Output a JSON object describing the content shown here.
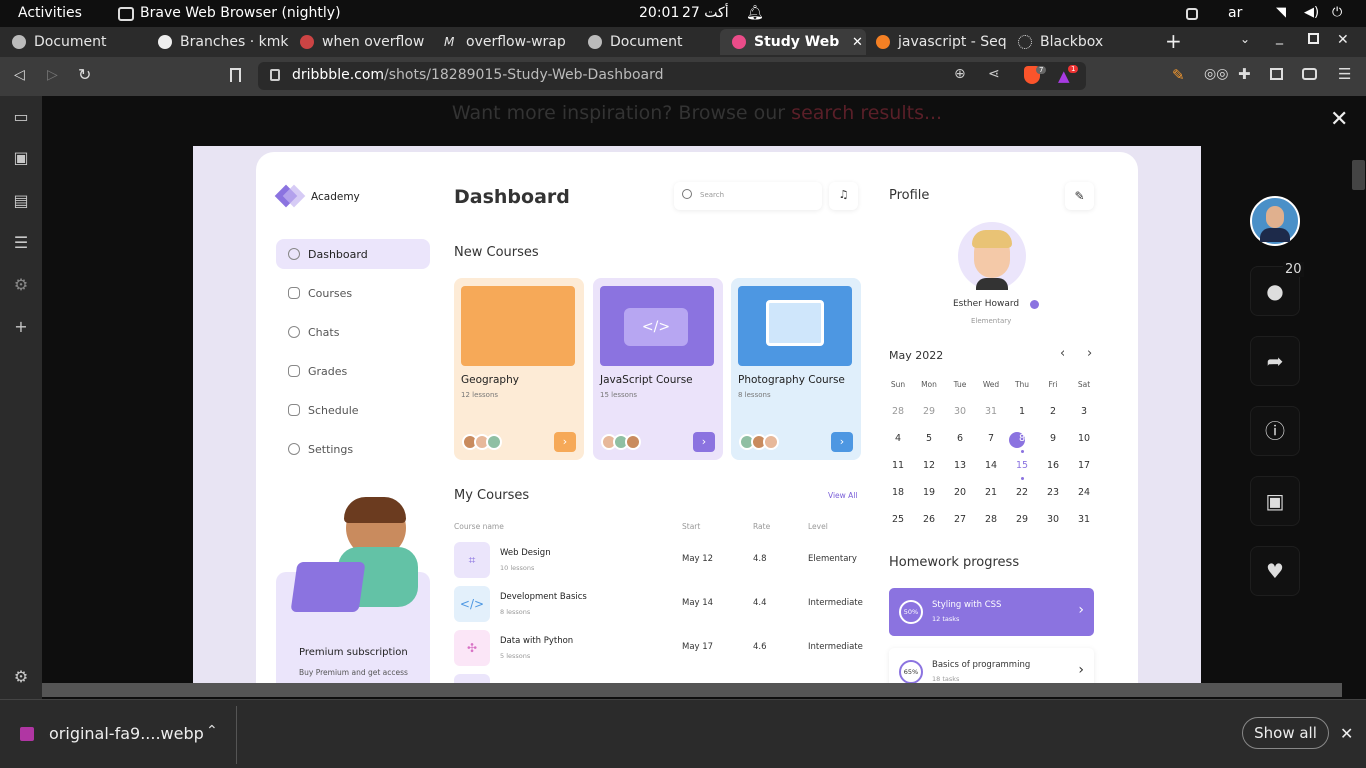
{
  "system": {
    "activities": "Activities",
    "app_name": "Brave Web Browser (nightly)",
    "clock": "20:01",
    "date": "أكت 27",
    "lang": "ar"
  },
  "tabs": [
    {
      "label": "Document"
    },
    {
      "label": "Branches · kmk"
    },
    {
      "label": "when overflow"
    },
    {
      "label": "overflow-wrap"
    },
    {
      "label": "Document"
    },
    {
      "label": "Study Web D"
    },
    {
      "label": "javascript - Seq"
    },
    {
      "label": "Blackbox"
    }
  ],
  "url": {
    "host": "dribbble.com",
    "path": "/shots/18289015-Study-Web-Dashboard"
  },
  "badges": {
    "shields": "7",
    "rewards": "1"
  },
  "banner": {
    "prefix": "Want more inspiration? Browse our ",
    "link": "search results..."
  },
  "shot": {
    "brand": "Academy",
    "page_title": "Dashboard",
    "search_placeholder": "Search",
    "nav": [
      {
        "label": "Dashboard"
      },
      {
        "label": "Courses"
      },
      {
        "label": "Chats"
      },
      {
        "label": "Grades"
      },
      {
        "label": "Schedule"
      },
      {
        "label": "Settings"
      }
    ],
    "premium": {
      "title": "Premium subscription",
      "text": "Buy Premium and get access"
    },
    "new_courses_title": "New Courses",
    "new_courses": [
      {
        "title": "Geography",
        "lessons": "12 lessons",
        "bg": "#fdebd6",
        "img": "#f6a958",
        "btn": "#f6a958"
      },
      {
        "title": "JavaScript Course",
        "lessons": "15 lessons",
        "bg": "#ebe3fa",
        "img": "#8b73e0",
        "btn": "#8b73e0"
      },
      {
        "title": "Photography Course",
        "lessons": "8 lessons",
        "bg": "#e0effb",
        "img": "#4d97e2",
        "btn": "#4d97e2"
      }
    ],
    "my_courses": {
      "title": "My Courses",
      "view_all": "View All",
      "headers": [
        "Course name",
        "Start",
        "Rate",
        "Level"
      ],
      "rows": [
        {
          "name": "Web Design",
          "lessons": "10 lessons",
          "start": "May 12",
          "rate": "4.8",
          "level": "Elementary"
        },
        {
          "name": "Development Basics",
          "lessons": "8 lessons",
          "start": "May 14",
          "rate": "4.4",
          "level": "Intermediate"
        },
        {
          "name": "Data with Python",
          "lessons": "5 lessons",
          "start": "May 17",
          "rate": "4.6",
          "level": "Intermediate"
        }
      ]
    },
    "profile": {
      "title": "Profile",
      "name": "Esther Howard",
      "level": "Elementary"
    },
    "calendar": {
      "month": "May 2022",
      "days": [
        "Sun",
        "Mon",
        "Tue",
        "Wed",
        "Thu",
        "Fri",
        "Sat"
      ],
      "weeks": [
        [
          "28",
          "29",
          "30",
          "31",
          "1",
          "2",
          "3"
        ],
        [
          "4",
          "5",
          "6",
          "7",
          "8",
          "9",
          "10"
        ],
        [
          "11",
          "12",
          "13",
          "14",
          "15",
          "16",
          "17"
        ],
        [
          "18",
          "19",
          "20",
          "21",
          "22",
          "23",
          "24"
        ],
        [
          "25",
          "26",
          "27",
          "28",
          "29",
          "30",
          "31"
        ]
      ]
    },
    "homework": {
      "title": "Homework progress",
      "items": [
        {
          "percent": "50%",
          "title": "Styling with CSS",
          "tasks": "12 tasks"
        },
        {
          "percent": "65%",
          "title": "Basics of programming",
          "tasks": "18 tasks"
        }
      ]
    }
  },
  "side_actions": {
    "comments_count": "20"
  },
  "download": {
    "file": "original-fa9....webp",
    "show_all": "Show all"
  }
}
